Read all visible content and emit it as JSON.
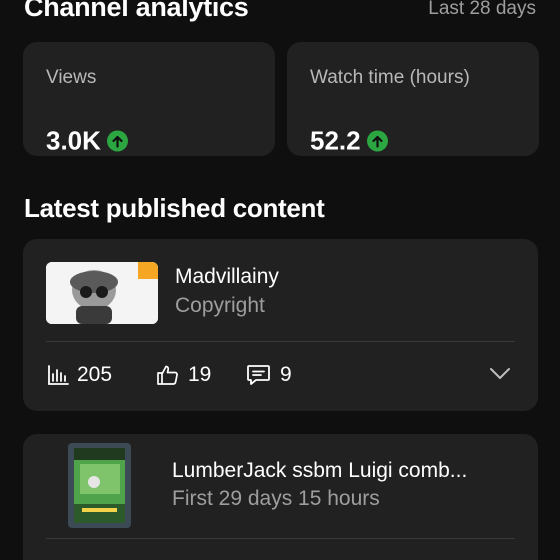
{
  "header": {
    "title": "Channel analytics",
    "range": "Last 28 days"
  },
  "stats": [
    {
      "label": "Views",
      "value": "3.0K",
      "trend": "up"
    },
    {
      "label": "Watch time (hours)",
      "value": "52.2",
      "trend": "up"
    }
  ],
  "section": {
    "title": "Latest published content"
  },
  "items": [
    {
      "title": "Madvillainy",
      "subtitle": "Copyright",
      "views": "205",
      "likes": "19",
      "comments": "9"
    },
    {
      "title": "LumberJack ssbm Luigi comb...",
      "subtitle": "First 29 days 15 hours"
    }
  ],
  "colors": {
    "background": "#0f0f0f",
    "card": "#212121",
    "trend_up": "#2ba640",
    "badge": "#f5a623"
  }
}
